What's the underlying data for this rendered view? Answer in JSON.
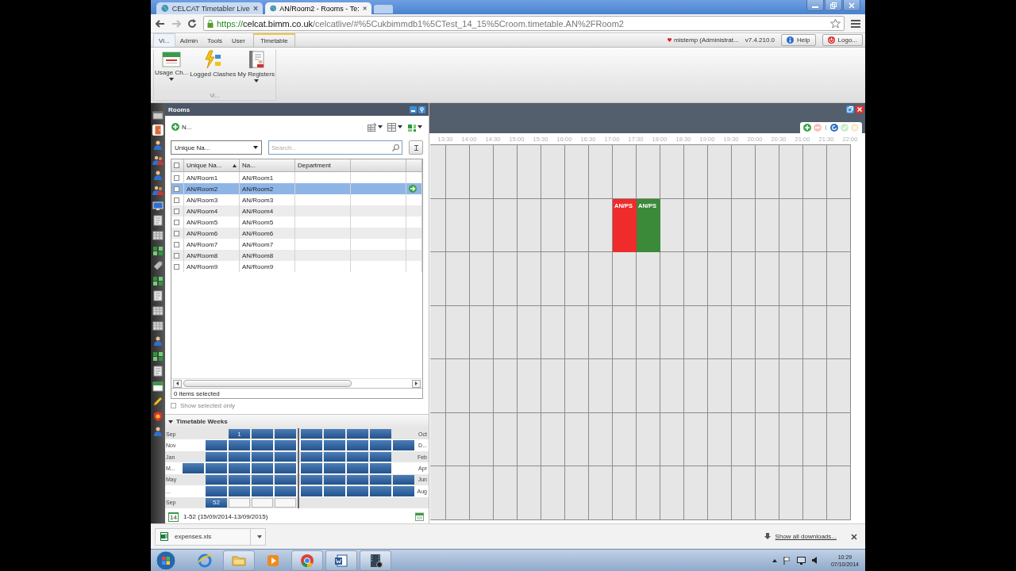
{
  "browser": {
    "tabs": [
      {
        "title": "CELCAT Timetabler Live",
        "selected": false
      },
      {
        "title": "AN/Room2 - Rooms - Te:",
        "selected": true
      }
    ],
    "url": {
      "scheme": "https://",
      "host": "celcat.bimm.co.uk",
      "path": "/celcatlive/#%5Cukbimmdb1%5CTest_14_15%5Croom.timetable.AN%2FRoom2"
    }
  },
  "menu": {
    "items": [
      {
        "label": "Vi...",
        "selected": true,
        "kind": "tab"
      },
      {
        "label": "Admin",
        "selected": false,
        "kind": "tab"
      },
      {
        "label": "Tools",
        "selected": false,
        "kind": "tab"
      },
      {
        "label": "User",
        "selected": false,
        "kind": "tab"
      },
      {
        "label": "Timetable",
        "selected": false,
        "kind": "context"
      }
    ],
    "user": "mistemp (Administrat...",
    "version": "v7.4.210.0",
    "buttons": [
      {
        "label": "Help",
        "kind": "help"
      },
      {
        "label": "Logo...",
        "kind": "logout"
      }
    ]
  },
  "ribbon": {
    "buttons": [
      {
        "label": "Usage Ch...",
        "kind": "calendar",
        "dropdown": true
      },
      {
        "label": "Logged Clashes",
        "kind": "clash",
        "dropdown": false
      },
      {
        "label": "My Registers",
        "kind": "register",
        "dropdown": true
      }
    ],
    "group": "Vi..."
  },
  "nav_rail": {
    "items": [
      {
        "kind": "window",
        "selected": false
      },
      {
        "kind": "door",
        "selected": true
      },
      {
        "kind": "person",
        "selected": false
      },
      {
        "kind": "people",
        "selected": false
      },
      {
        "kind": "person",
        "selected": false
      },
      {
        "kind": "people",
        "selected": false
      },
      {
        "kind": "monitor",
        "selected": false
      },
      {
        "kind": "document",
        "selected": false
      },
      {
        "kind": "grid",
        "selected": false
      },
      {
        "kind": "chart",
        "selected": false
      },
      {
        "kind": "tag",
        "selected": false
      },
      {
        "kind": "chart",
        "selected": false
      },
      {
        "kind": "document",
        "selected": false
      },
      {
        "kind": "grid",
        "selected": false
      },
      {
        "kind": "grid",
        "selected": false
      },
      {
        "kind": "person",
        "selected": false
      },
      {
        "kind": "chart",
        "selected": false
      },
      {
        "kind": "document",
        "selected": false
      },
      {
        "kind": "calendar",
        "selected": false
      },
      {
        "kind": "pencil",
        "selected": false
      },
      {
        "kind": "badge",
        "selected": false
      },
      {
        "kind": "person",
        "selected": false
      }
    ]
  },
  "rooms": {
    "title": "Rooms",
    "new_button": "N...",
    "filter": "Unique Na...",
    "search": {
      "placeholder": "Search..."
    },
    "select_all": {
      "checked": false
    },
    "columns": [
      {
        "label": "Unique Na...",
        "sorted": true
      },
      {
        "label": "Na...",
        "sorted": false
      },
      {
        "label": "Department",
        "sorted": false
      }
    ],
    "rows": [
      {
        "unique_name": "AN/Room1",
        "name": "AN/Room1",
        "checked": false,
        "selected": false
      },
      {
        "unique_name": "AN/Room2",
        "name": "AN/Room2",
        "checked": false,
        "selected": true
      },
      {
        "unique_name": "AN/Room3",
        "name": "AN/Room3",
        "checked": false,
        "selected": false
      },
      {
        "unique_name": "AN/Room4",
        "name": "AN/Room4",
        "checked": false,
        "selected": false
      },
      {
        "unique_name": "AN/Room5",
        "name": "AN/Room5",
        "checked": false,
        "selected": false
      },
      {
        "unique_name": "AN/Room6",
        "name": "AN/Room6",
        "checked": false,
        "selected": false
      },
      {
        "unique_name": "AN/Room7",
        "name": "AN/Room7",
        "checked": false,
        "selected": false
      },
      {
        "unique_name": "AN/Room8",
        "name": "AN/Room8",
        "checked": false,
        "selected": false
      },
      {
        "unique_name": "AN/Room9",
        "name": "AN/Room9",
        "checked": false,
        "selected": false
      }
    ],
    "status": "0 items selected",
    "show_selected": {
      "label": "Show selected only",
      "checked": false
    }
  },
  "weeks": {
    "title": "Timetable Weeks",
    "expanded": true,
    "rows": [
      {
        "left": "Sep",
        "right": "Oct",
        "cells": [
          {
            "kind": "gap"
          },
          {
            "kind": "gap"
          },
          {
            "kind": "filled",
            "label": "1"
          },
          {
            "kind": "filled"
          },
          {
            "kind": "filled"
          },
          {
            "kind": "filled"
          },
          {
            "kind": "filled"
          },
          {
            "kind": "filled"
          },
          {
            "kind": "filled"
          },
          {
            "kind": "gap"
          }
        ]
      },
      {
        "left": "Nov",
        "right": "D...",
        "cells": [
          {
            "kind": "gap"
          },
          {
            "kind": "filled"
          },
          {
            "kind": "filled"
          },
          {
            "kind": "filled"
          },
          {
            "kind": "filled"
          },
          {
            "kind": "filled"
          },
          {
            "kind": "filled"
          },
          {
            "kind": "filled"
          },
          {
            "kind": "filled"
          },
          {
            "kind": "filled"
          }
        ]
      },
      {
        "left": "Jan",
        "right": "Feb",
        "cells": [
          {
            "kind": "gap"
          },
          {
            "kind": "filled"
          },
          {
            "kind": "filled"
          },
          {
            "kind": "filled"
          },
          {
            "kind": "filled"
          },
          {
            "kind": "filled"
          },
          {
            "kind": "filled"
          },
          {
            "kind": "filled"
          },
          {
            "kind": "filled"
          },
          {
            "kind": "gap"
          }
        ]
      },
      {
        "left": "M...",
        "right": "Apr",
        "cells": [
          {
            "kind": "filled"
          },
          {
            "kind": "filled"
          },
          {
            "kind": "filled"
          },
          {
            "kind": "filled"
          },
          {
            "kind": "filled"
          },
          {
            "kind": "filled"
          },
          {
            "kind": "filled"
          },
          {
            "kind": "filled"
          },
          {
            "kind": "filled"
          },
          {
            "kind": "gap"
          }
        ]
      },
      {
        "left": "May",
        "right": "Jun",
        "cells": [
          {
            "kind": "gap"
          },
          {
            "kind": "filled"
          },
          {
            "kind": "filled"
          },
          {
            "kind": "filled"
          },
          {
            "kind": "filled"
          },
          {
            "kind": "filled"
          },
          {
            "kind": "filled"
          },
          {
            "kind": "filled"
          },
          {
            "kind": "filled"
          },
          {
            "kind": "filled"
          }
        ]
      },
      {
        "left": "...",
        "right": "Aug",
        "cells": [
          {
            "kind": "gap"
          },
          {
            "kind": "filled"
          },
          {
            "kind": "filled"
          },
          {
            "kind": "filled"
          },
          {
            "kind": "filled"
          },
          {
            "kind": "filled"
          },
          {
            "kind": "filled"
          },
          {
            "kind": "filled"
          },
          {
            "kind": "filled"
          },
          {
            "kind": "filled"
          }
        ]
      },
      {
        "left": "Sep",
        "cells": [
          {
            "kind": "gap"
          },
          {
            "kind": "filled",
            "label": "52"
          },
          {
            "kind": "empty"
          },
          {
            "kind": "empty"
          },
          {
            "kind": "empty"
          },
          {
            "kind": "gap"
          },
          {
            "kind": "gap"
          },
          {
            "kind": "gap"
          },
          {
            "kind": "gap"
          },
          {
            "kind": "gap"
          }
        ]
      }
    ],
    "date_badge": "14",
    "range": "1-52 (15/09/2014-13/09/2015)"
  },
  "timetable": {
    "toolbar": [
      {
        "kind": "add",
        "disabled": false
      },
      {
        "kind": "remove",
        "disabled": true
      },
      {
        "kind": "refresh",
        "disabled": false
      },
      {
        "kind": "confirm",
        "disabled": true
      },
      {
        "kind": "cancel",
        "disabled": true
      }
    ],
    "times": [
      {
        "label": "13:30"
      },
      {
        "label": "14:00"
      },
      {
        "label": "14:30"
      },
      {
        "label": "15:00"
      },
      {
        "label": "15:30"
      },
      {
        "label": "16:00"
      },
      {
        "label": "16:30"
      },
      {
        "label": "17:00",
        "rows": [
          null,
          {
            "label": "AN/PS",
            "color": "#f02b2b"
          }
        ]
      },
      {
        "label": "17:30",
        "rows": [
          null,
          {
            "label": "AN/PS",
            "color": "#3a8a3a"
          }
        ]
      },
      {
        "label": "18:00"
      },
      {
        "label": "18:30"
      },
      {
        "label": "19:00"
      },
      {
        "label": "19:30"
      },
      {
        "label": "20:00"
      },
      {
        "label": "20:30"
      },
      {
        "label": "21:00"
      },
      {
        "label": "21:30"
      },
      {
        "label": "22:00"
      }
    ]
  },
  "downloads": {
    "file": "expenses.xls",
    "link": "Show all downloads..."
  },
  "taskbar": {
    "apps": [
      {
        "kind": "ie",
        "running": false
      },
      {
        "kind": "folder",
        "running": true
      },
      {
        "kind": "media",
        "running": false
      },
      {
        "kind": "chrome",
        "running": true
      },
      {
        "kind": "word",
        "running": true
      },
      {
        "kind": "video",
        "running": true
      }
    ],
    "time": "10:29",
    "date": "07/10/2014"
  }
}
